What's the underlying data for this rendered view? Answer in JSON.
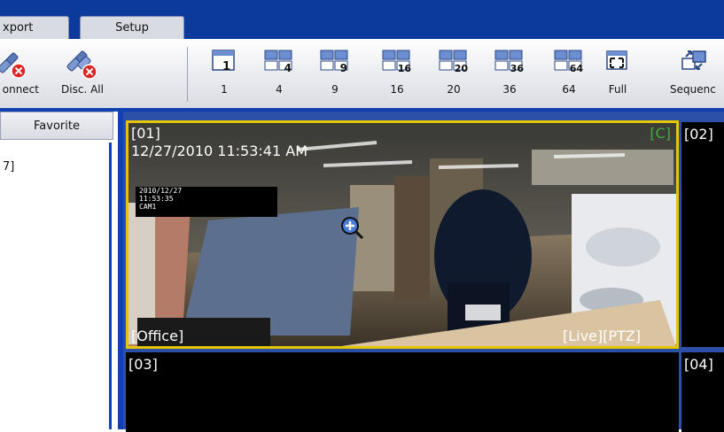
{
  "tabs": [
    {
      "label": "xport"
    },
    {
      "label": "Setup"
    }
  ],
  "toolbar": {
    "connect_label": "onnect",
    "disc_all_label": "Disc. All",
    "layouts": [
      {
        "label": "1",
        "num": "1"
      },
      {
        "label": "4",
        "num": "4"
      },
      {
        "label": "9",
        "num": "9"
      },
      {
        "label": "16",
        "num": "16"
      },
      {
        "label": "20",
        "num": "20"
      },
      {
        "label": "36",
        "num": "36"
      },
      {
        "label": "64",
        "num": "64"
      }
    ],
    "full_label": "Full",
    "sequence_label": "Sequenc"
  },
  "left_panel": {
    "header": "Favorite",
    "item": "7]"
  },
  "cameras": [
    {
      "id": "[01]",
      "datetime": "12/27/2010 11:53:41 AM",
      "indicator": "[C]",
      "name": "[Office]",
      "status": "[Live][PTZ]",
      "osd_lines": [
        "2010/12/27",
        "11:53:35",
        "CAM1"
      ]
    },
    {
      "id": "[02]"
    },
    {
      "id": "[03]"
    },
    {
      "id": "[04]"
    }
  ],
  "colors": {
    "accent_blue": "#1140b0",
    "selected_border": "#e6c400",
    "indicator_green": "#3fae3f"
  }
}
